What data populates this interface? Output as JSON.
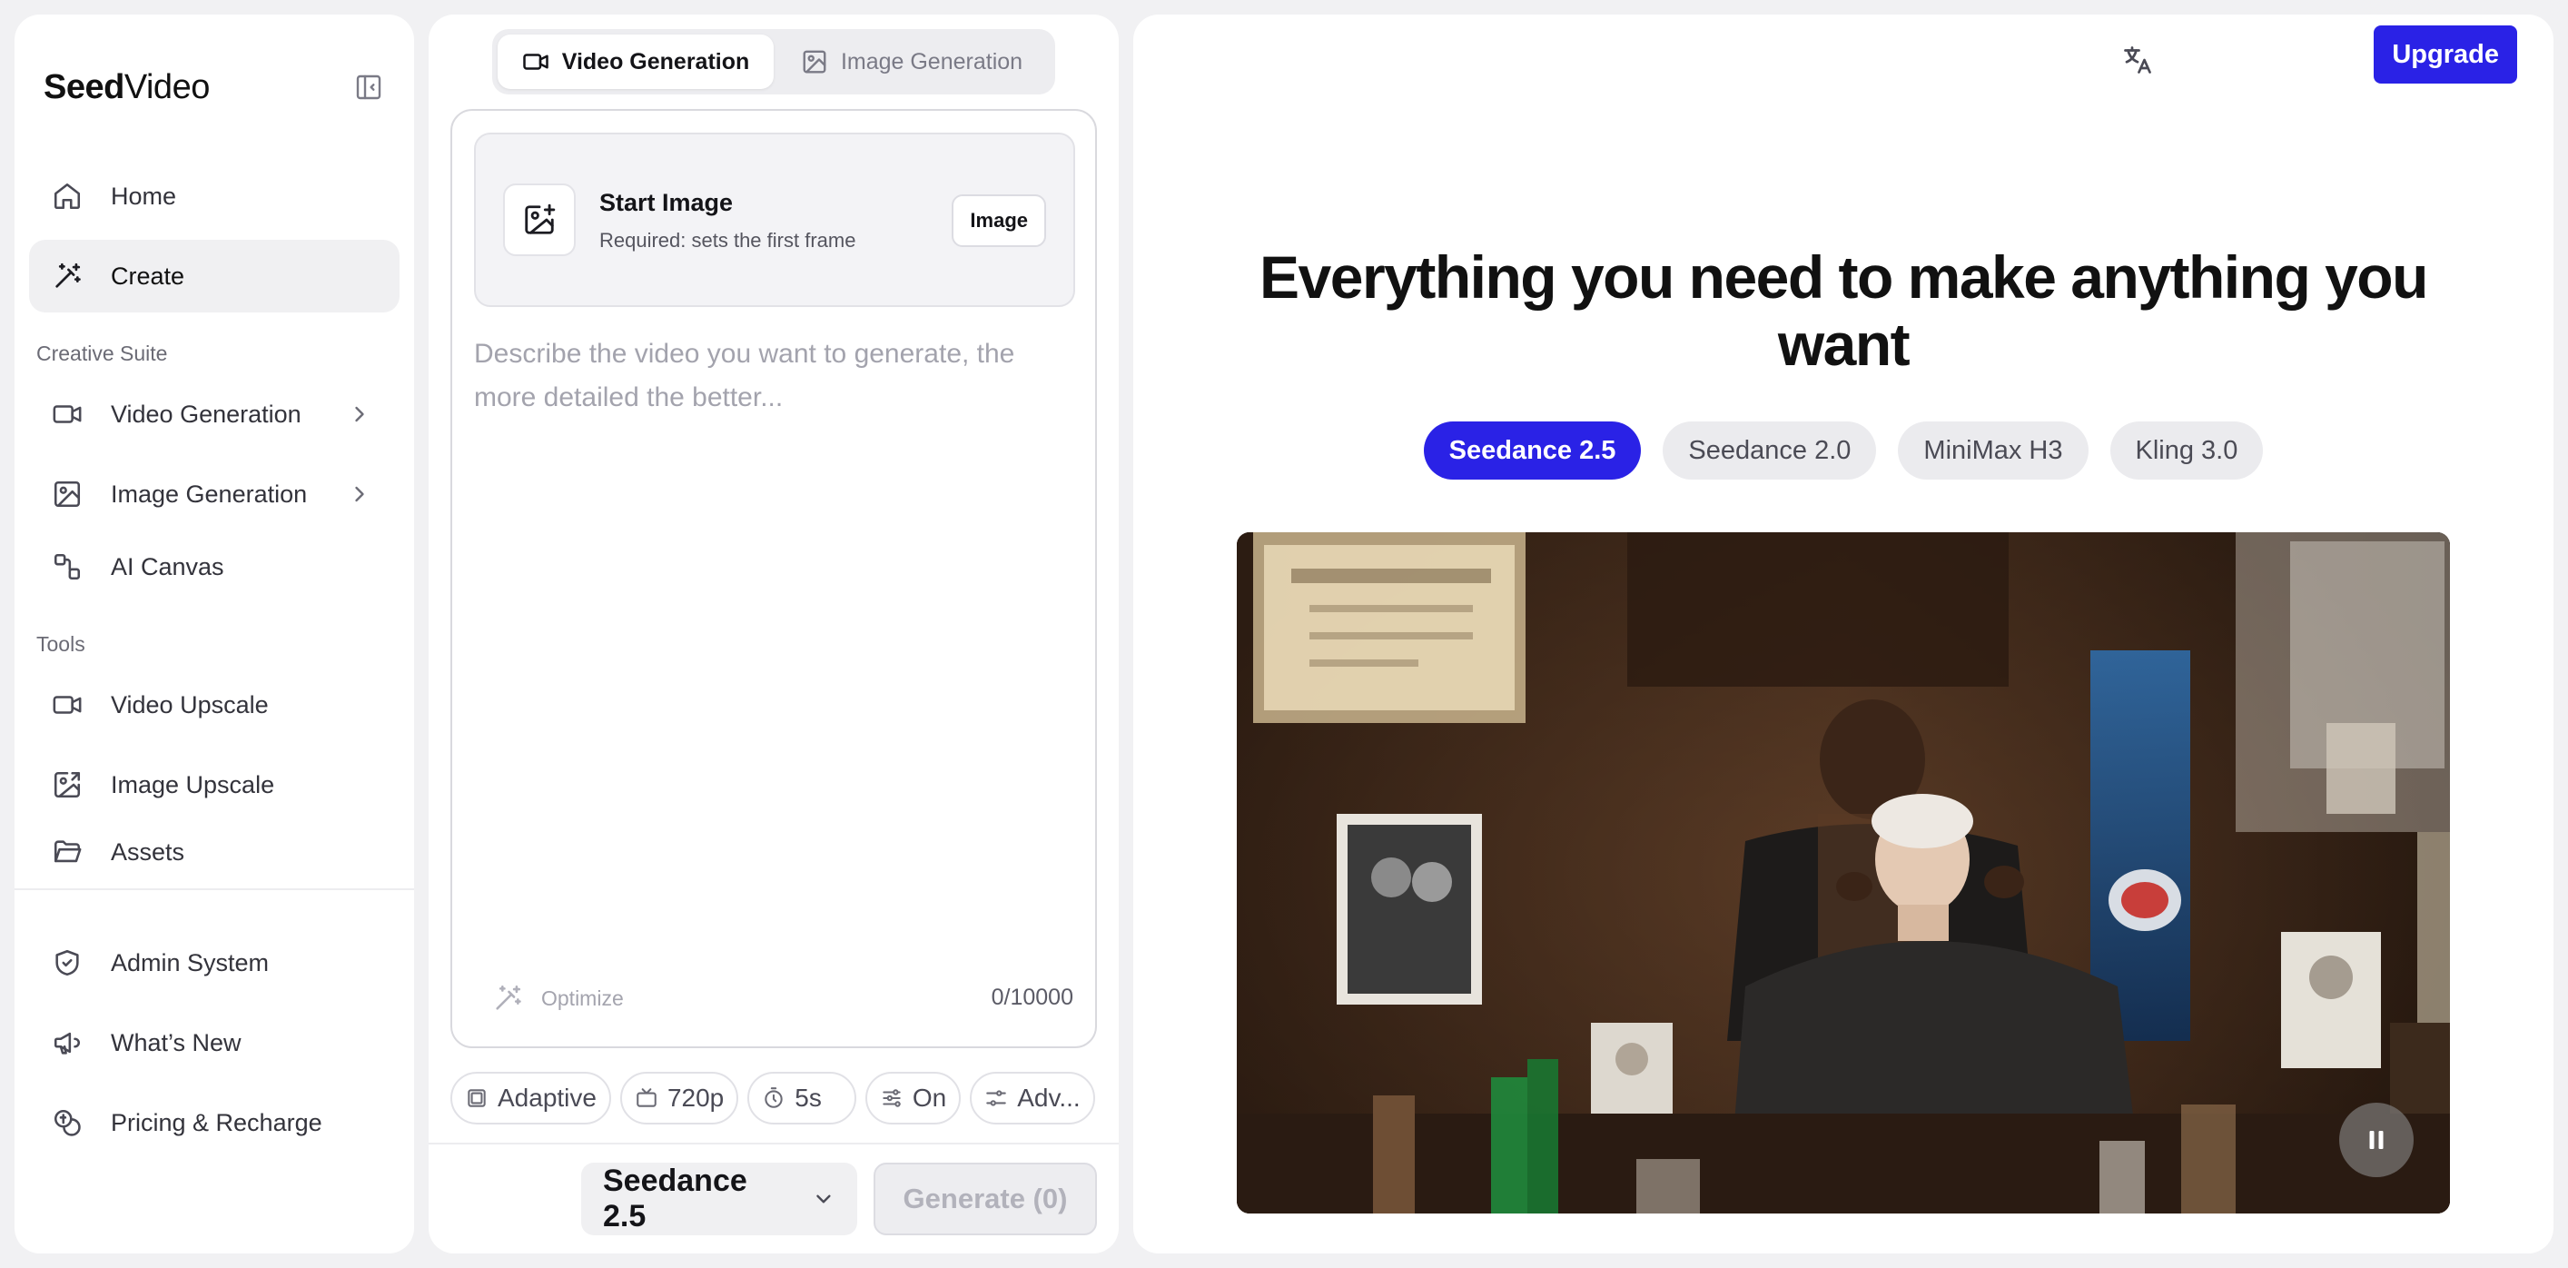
{
  "sidebar": {
    "brand": {
      "bold": "Seed",
      "light": "Video"
    },
    "items": [
      {
        "label": "Home"
      },
      {
        "label": "Create"
      },
      {
        "label": "Video Generation"
      },
      {
        "label": "Image Generation"
      },
      {
        "label": "AI Canvas"
      },
      {
        "label": "Video Upscale"
      },
      {
        "label": "Image Upscale"
      },
      {
        "label": "Assets"
      },
      {
        "label": "Admin System"
      },
      {
        "label": "What’s New"
      },
      {
        "label": "Pricing & Recharge"
      }
    ],
    "sections": {
      "creative": "Creative Suite",
      "tools": "Tools"
    },
    "active_item": "Create"
  },
  "composer": {
    "tabs": [
      {
        "label": "Video Generation"
      },
      {
        "label": "Image Generation"
      }
    ],
    "active_tab": "Video Generation",
    "start_image": {
      "title": "Start Image",
      "subtitle": "Required: sets the first frame",
      "button": "Image"
    },
    "prompt": {
      "value": "",
      "placeholder": "Describe the video you want to generate, the more detailed the better..."
    },
    "optimize_label": "Optimize",
    "char_count": "0/10000",
    "params": [
      {
        "label": "Adaptive",
        "icon": "aspect-ratio-icon"
      },
      {
        "label": "720p",
        "icon": "resolution-icon"
      },
      {
        "label": "5s",
        "icon": "timer-icon"
      },
      {
        "label": "On",
        "icon": "sliders-icon"
      },
      {
        "label": "Adv...",
        "icon": "settings-icon"
      }
    ],
    "model_select": "Seedance 2.5",
    "generate_label": "Generate (0)"
  },
  "main": {
    "upgrade_label": "Upgrade",
    "headline": "Everything you need to make anything you want",
    "models": [
      {
        "label": "Seedance 2.5"
      },
      {
        "label": "Seedance 2.0"
      },
      {
        "label": "MiniMax H3"
      },
      {
        "label": "Kling 3.0"
      }
    ],
    "active_model": "Seedance 2.5",
    "video": {
      "playing": true,
      "description_icon": "pause-icon"
    }
  },
  "colors": {
    "accent": "#2a22e6",
    "page_bg": "#f1f1f3",
    "panel_bg": "#ffffff"
  }
}
